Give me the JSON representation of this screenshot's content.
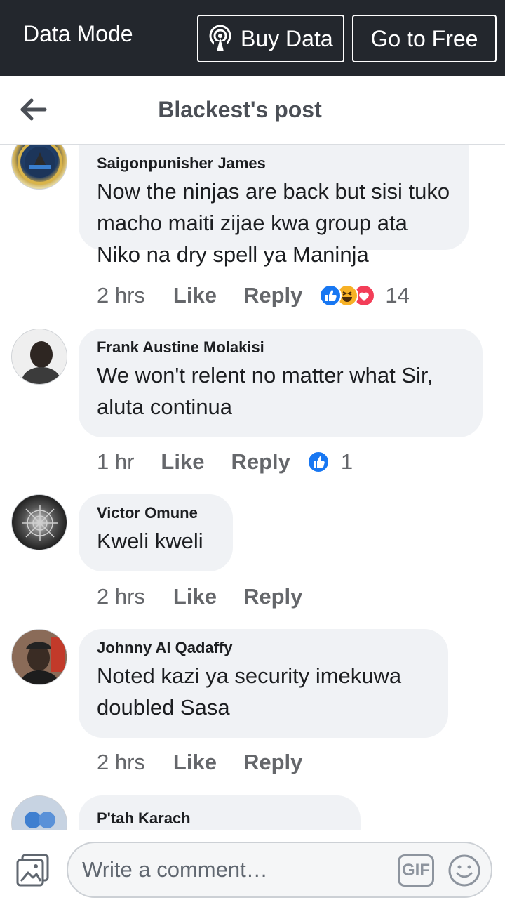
{
  "topbar": {
    "mode_label": "Data Mode",
    "buy_label": "Buy Data",
    "free_label": "Go to Free",
    "background": "#23272d"
  },
  "header": {
    "title": "Blackest's post"
  },
  "comments": [
    {
      "author": "Saigonpunisher James",
      "text": "Now the ninjas are back but sisi tuko macho maiti zijae kwa group ata Niko na dry spell ya Maninja",
      "time": "2 hrs",
      "like_label": "Like",
      "reply_label": "Reply",
      "reactions": [
        "like",
        "haha",
        "love"
      ],
      "reaction_count": "14"
    },
    {
      "author": "Frank Austine Molakisi",
      "text": "We won't relent no matter what Sir, aluta continua",
      "time": "1 hr",
      "like_label": "Like",
      "reply_label": "Reply",
      "reactions": [
        "like"
      ],
      "reaction_count": "1"
    },
    {
      "author": "Victor Omune",
      "text": "Kweli kweli",
      "time": "2 hrs",
      "like_label": "Like",
      "reply_label": "Reply"
    },
    {
      "author": "Johnny Al Qadaffy",
      "text": "Noted kazi ya security imekuwa doubled Sasa",
      "time": "2 hrs",
      "like_label": "Like",
      "reply_label": "Reply"
    },
    {
      "author": "P'tah Karach"
    }
  ],
  "composer": {
    "placeholder": "Write a comment…",
    "gif_label": "GIF"
  },
  "colors": {
    "like_blue": "#1877f2",
    "love_red": "#f33e58",
    "haha_yellow": "#f7b125",
    "bubble": "#f0f2f5",
    "meta_gray": "#65676b"
  }
}
